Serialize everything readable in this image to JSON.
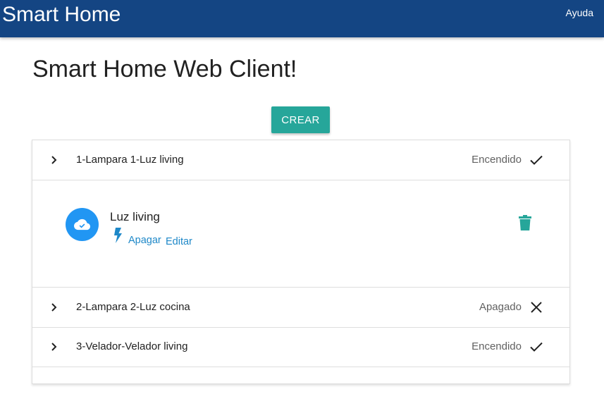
{
  "navbar": {
    "brand": "Smart Home",
    "help_label": "Ayuda",
    "background_color": "#144583"
  },
  "page": {
    "title": "Smart Home Web Client!"
  },
  "toolbar": {
    "create_label": "CREAR",
    "create_color": "#26a69a"
  },
  "devices": [
    {
      "label": "1-Lampara 1-Luz living",
      "state": "Encendido",
      "status_icon": "check-icon",
      "expanded": true,
      "detail": {
        "name": "Luz living",
        "action_label": "Apagar",
        "edit_label": "Editar",
        "avatar_icon": "cloud-done-icon",
        "action_icon": "bolt-icon",
        "delete_icon": "trash-icon"
      }
    },
    {
      "label": "2-Lampara 2-Luz cocina",
      "state": "Apagado",
      "status_icon": "close-icon",
      "expanded": false
    },
    {
      "label": "3-Velador-Velador living",
      "state": "Encendido",
      "status_icon": "check-icon",
      "expanded": false
    }
  ]
}
